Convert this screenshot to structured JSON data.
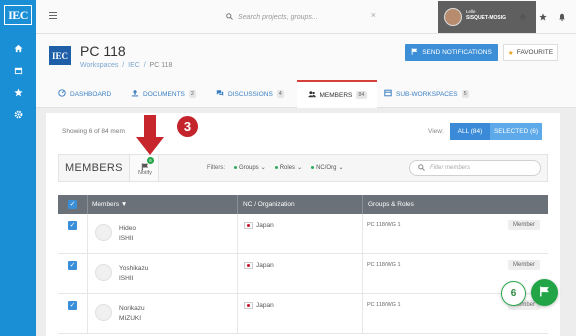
{
  "rail": {
    "logo": "IEC",
    "items": [
      {
        "icon": "home-icon"
      },
      {
        "icon": "calendar-icon"
      },
      {
        "icon": "star-icon"
      },
      {
        "icon": "gear-icon"
      }
    ]
  },
  "topbar": {
    "search_placeholder": "Search projects, groups...",
    "user_line1": "Lelle",
    "user_line2": "SISQUET-MOSIG",
    "icons": [
      "home-icon",
      "star-icon",
      "bell-icon"
    ]
  },
  "header": {
    "logo": "IEC",
    "title": "PC 118",
    "breadcrumb": [
      "Workspaces",
      "IEC",
      "PC 118"
    ],
    "breadcrumb_sep": "/",
    "notify_button": "SEND NOTIFICATIONS",
    "favourite_button": "FAVOURITE"
  },
  "tabs": [
    {
      "label": "DASHBOARD",
      "count": "",
      "icon": "dashboard-icon",
      "active": false
    },
    {
      "label": "DOCUMENTS",
      "count": "2",
      "icon": "upload-icon",
      "active": false
    },
    {
      "label": "DISCUSSIONS",
      "count": "4",
      "icon": "discussion-icon",
      "active": false
    },
    {
      "label": "MEMBERS",
      "count": "84",
      "icon": "members-icon",
      "active": true
    },
    {
      "label": "SUB-WORKSPACES",
      "count": "5",
      "icon": "subworkspace-icon",
      "active": false
    }
  ],
  "members": {
    "showing": "Showing 6 of 84 mem",
    "view_label": "View:",
    "view_all": "ALL (84)",
    "view_selected": "SELECTED (6)",
    "section_title": "MEMBERS",
    "notify_label": "Notify",
    "notify_badge": "6",
    "filters_label": "Filters:",
    "filter_groups": "Groups",
    "filter_roles": "Roles",
    "filter_nc": "NC/Org",
    "filter_search_placeholder": "Filter members",
    "columns": [
      "Members ▼",
      "NC / Organization",
      "Groups & Roles"
    ],
    "rows": [
      {
        "first": "Hideo",
        "last": "ISHII",
        "org": "Japan",
        "group": "PC 118/WG 1",
        "role": "Member"
      },
      {
        "first": "Yoshikazu",
        "last": "ISHII",
        "org": "Japan",
        "group": "PC 118/WG 1",
        "role": "Member"
      },
      {
        "first": "Norikazu",
        "last": "MIZUKI",
        "org": "Japan",
        "group": "PC 118/WG 1",
        "role": "Member"
      }
    ]
  },
  "overlay": {
    "step_number": "3",
    "fab_count": "6"
  },
  "colors": {
    "brand_blue": "#1a8fd6",
    "active_tab": "#d6403a",
    "notify_green": "#22a447",
    "step_red": "#c4242b",
    "arrow_red": "#c8262d"
  }
}
